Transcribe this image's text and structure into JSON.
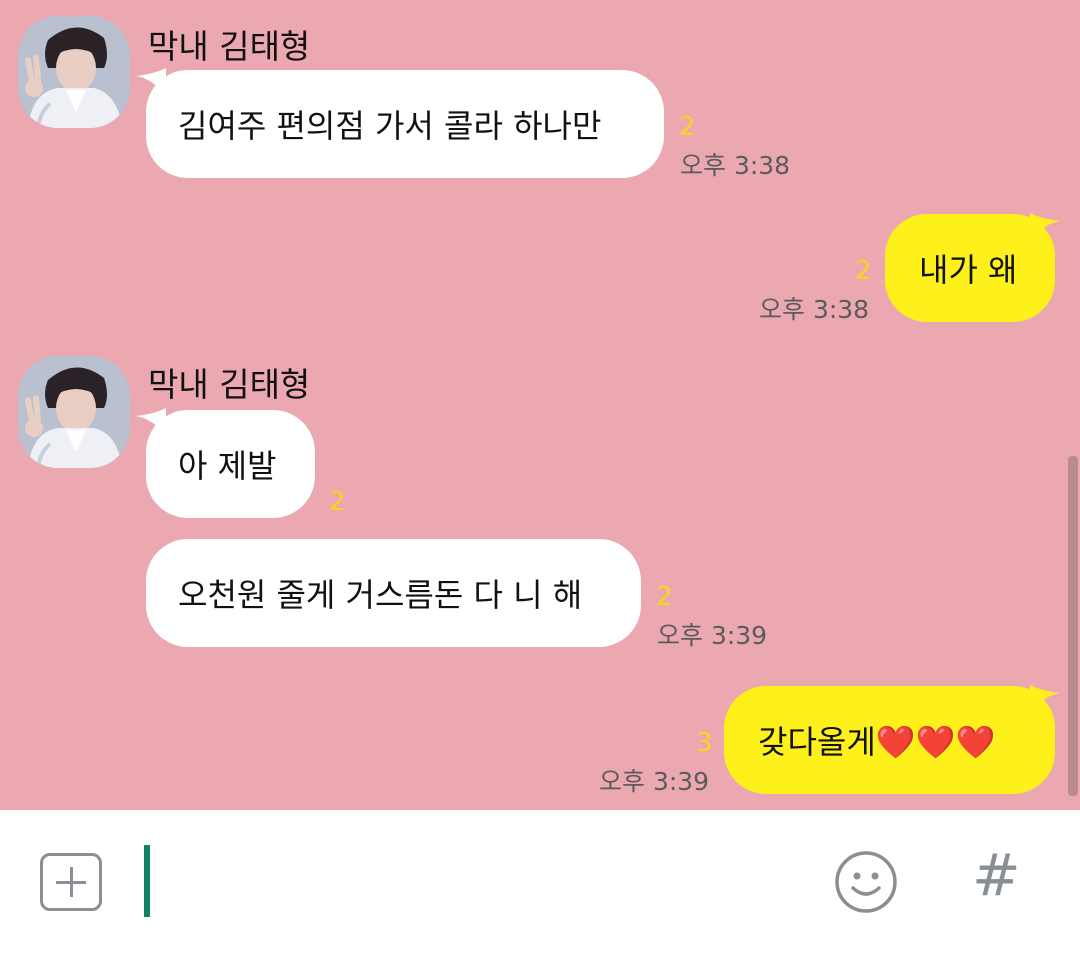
{
  "theme": {
    "chat_background": "#eba8b1",
    "incoming_bubble": "#ffffff",
    "outgoing_bubble": "#fef01b",
    "unread_color": "#f5d61a",
    "caret_color": "#10806b"
  },
  "messages": [
    {
      "direction": "in",
      "sender": "막내 김태형",
      "text": "김여주 편의점 가서 콜라 하나만",
      "unread": "2",
      "time": "오후 3:38"
    },
    {
      "direction": "out",
      "text": "내가 왜",
      "unread": "2",
      "time": "오후 3:38"
    },
    {
      "direction": "in",
      "sender": "막내 김태형",
      "text": "아 제발",
      "unread": "2",
      "time": ""
    },
    {
      "direction": "in",
      "text": "오천원 줄게 거스름돈 다 니 해",
      "unread": "2",
      "time": "오후 3:39"
    },
    {
      "direction": "out",
      "text": "갖다올게❤️❤️❤️",
      "unread": "3",
      "time": "오후 3:39"
    }
  ],
  "input_bar": {
    "placeholder": "",
    "value": "",
    "plus_icon": "plus-square-icon",
    "emoji_icon": "smiley-icon",
    "hash_label": "#"
  }
}
